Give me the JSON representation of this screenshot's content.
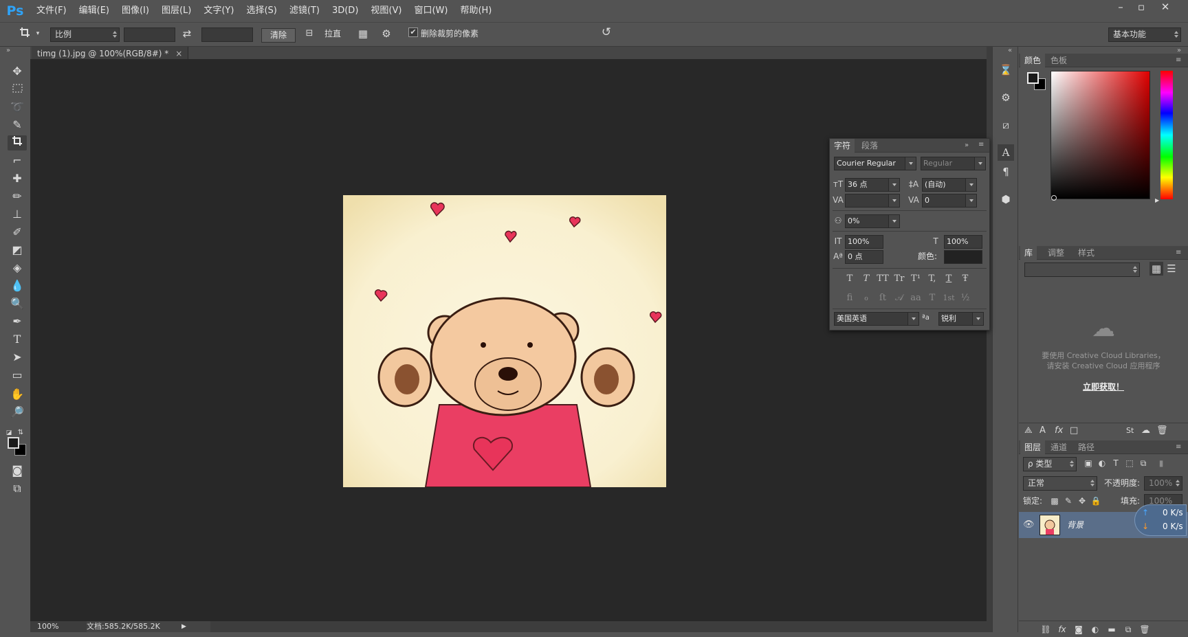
{
  "app": {
    "logo": "Ps",
    "menus": [
      "文件(F)",
      "编辑(E)",
      "图像(I)",
      "图层(L)",
      "文字(Y)",
      "选择(S)",
      "滤镜(T)",
      "3D(D)",
      "视图(V)",
      "窗口(W)",
      "帮助(H)"
    ],
    "window_controls": {
      "minimize": "–",
      "restore": "▫",
      "close": "✕"
    }
  },
  "options": {
    "ratio_label": "比例",
    "ratio_w": "",
    "ratio_h": "",
    "clear_label": "清除",
    "straighten_label": "拉直",
    "delete_cropped_label": "删除裁剪的像素",
    "delete_cropped_checked": true,
    "workspace": "基本功能"
  },
  "document": {
    "tab_title": "timg (1).jpg @ 100%(RGB/8#) *",
    "zoom": "100%",
    "doc_info": "文档:585.2K/585.2K"
  },
  "character_panel": {
    "tabs": [
      "字符",
      "段落"
    ],
    "font_family": "Courier Regular",
    "font_style": "Regular",
    "font_size": "36 点",
    "leading": "(自动)",
    "kerning": "",
    "tracking": "0",
    "tsume": "0%",
    "vertical_scale": "100%",
    "horizontal_scale": "100%",
    "baseline_shift": "0 点",
    "color_label": "颜色:",
    "type_buttons": [
      "T",
      "T",
      "TT",
      "Tr",
      "T¹",
      "T,",
      "T",
      "Ŧ"
    ],
    "opentype_buttons": [
      "fi",
      "ℴ",
      "ſt",
      "𝒜",
      "aa",
      "T",
      "1st",
      "½"
    ],
    "language": "美国英语",
    "aa_label": "ªa",
    "antialias": "锐利"
  },
  "color_panel": {
    "tabs": [
      "颜色",
      "色板"
    ],
    "accent": "#e00000"
  },
  "library_panel": {
    "tabs": [
      "库",
      "调整",
      "样式"
    ],
    "msg_line1": "要使用 Creative Cloud Libraries，",
    "msg_line2": "请安装 Creative Cloud 应用程序",
    "link": "立即获取！"
  },
  "layers_panel": {
    "tabs": [
      "图层",
      "通道",
      "路径"
    ],
    "filter_label": "ρ 类型",
    "blend_mode": "正常",
    "opacity_label": "不透明度:",
    "opacity_value": "100%",
    "lock_label": "锁定:",
    "fill_label": "填充:",
    "fill_value": "100%",
    "layer_name": "背景"
  },
  "net_overlay": {
    "up": "0 K/s",
    "down": "0 K/s"
  }
}
